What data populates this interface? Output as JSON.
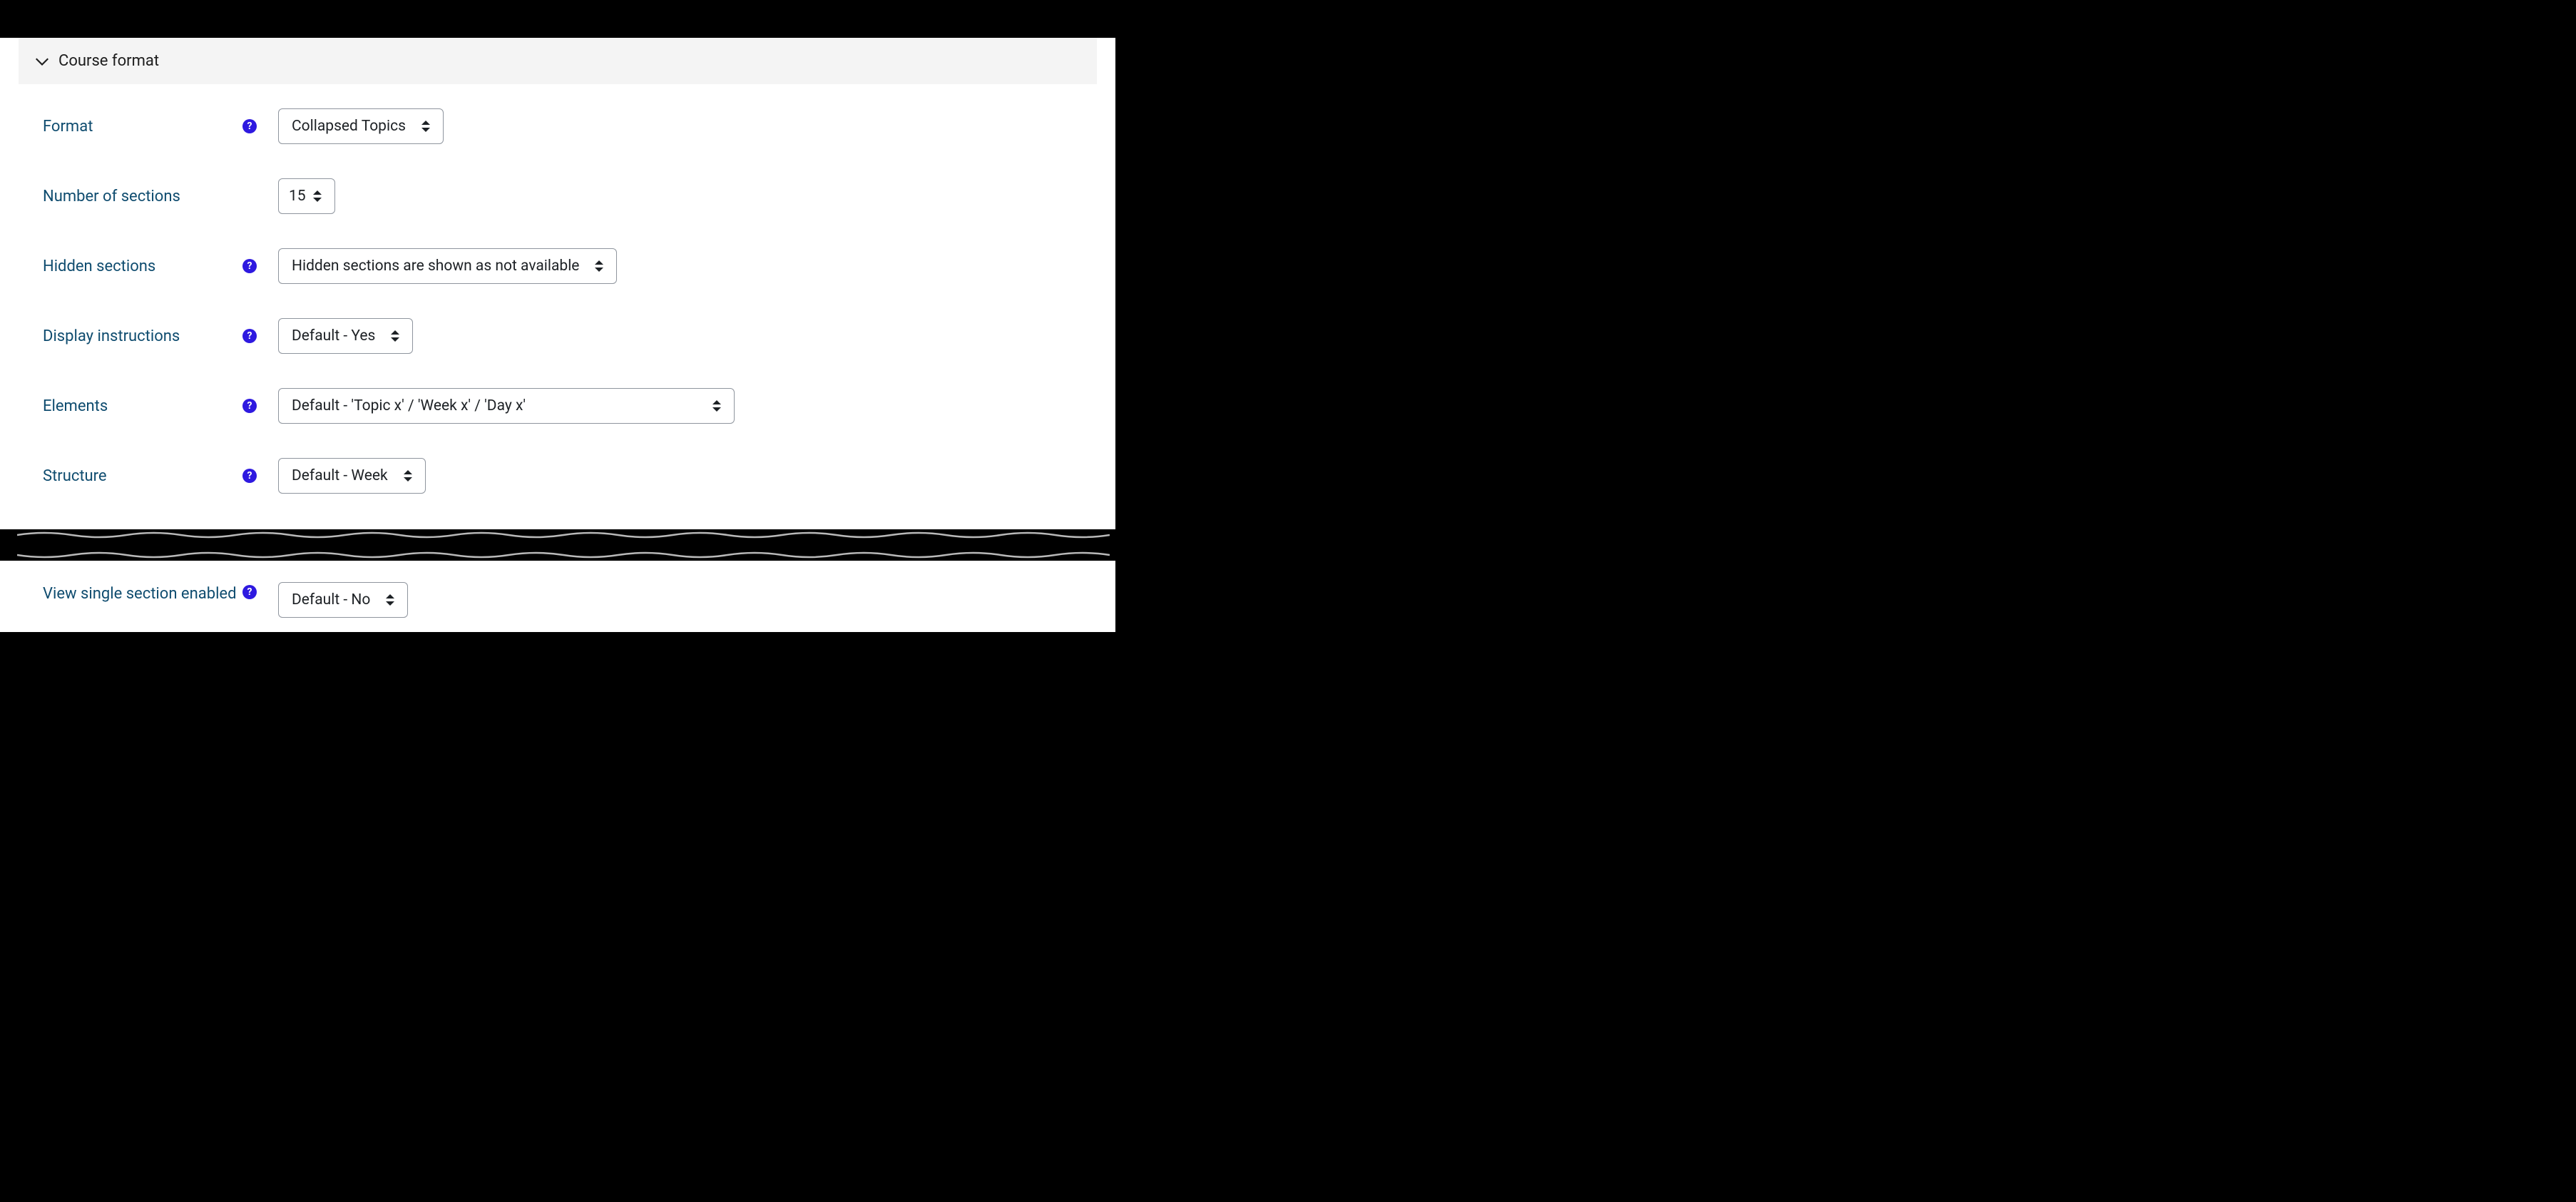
{
  "section": {
    "title": "Course format"
  },
  "fields": {
    "format": {
      "label": "Format",
      "value": "Collapsed Topics",
      "has_help": true
    },
    "num_sections": {
      "label": "Number of sections",
      "value": "15",
      "has_help": false
    },
    "hidden_sections": {
      "label": "Hidden sections",
      "value": "Hidden sections are shown as not available",
      "has_help": true
    },
    "display_instructions": {
      "label": "Display instructions",
      "value": "Default - Yes",
      "has_help": true
    },
    "elements": {
      "label": "Elements",
      "value": "Default - 'Topic x' / 'Week x' / 'Day x'",
      "has_help": true
    },
    "structure": {
      "label": "Structure",
      "value": "Default - Week",
      "has_help": true
    },
    "view_single_section": {
      "label": "View single section enabled",
      "value": "Default - No",
      "has_help": true
    }
  }
}
